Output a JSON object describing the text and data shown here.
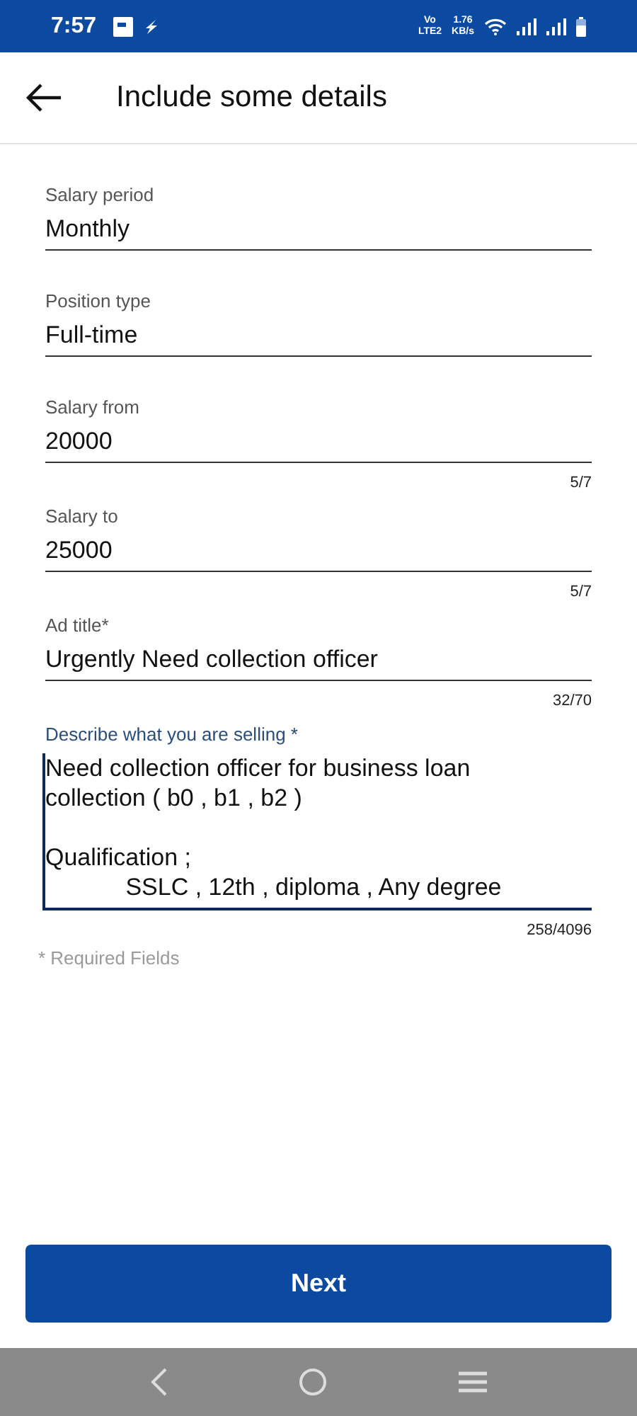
{
  "status_bar": {
    "time": "7:57",
    "network_top": "Vo",
    "network_bottom": "LTE2",
    "speed_value": "1.76",
    "speed_unit": "KB/s"
  },
  "header": {
    "title": "Include some details"
  },
  "fields": [
    {
      "label": "Salary period",
      "value": "Monthly",
      "focused": false
    },
    {
      "label": "Position type",
      "value": "Full-time",
      "focused": false
    },
    {
      "label": "Salary from",
      "value": "20000",
      "counter": "5/7",
      "focused": false
    },
    {
      "label": "Salary to",
      "value": "25000",
      "counter": "5/7",
      "focused": false
    },
    {
      "label": "Ad title*",
      "value": "Urgently Need collection officer",
      "counter": "32/70",
      "focused": false
    },
    {
      "label": "Describe what you are selling *",
      "value": "Need collection officer for business loan collection ( b0 , b1 , b2 )\n\nQualification ;\n            SSLC , 12th , diploma , Any degree",
      "counter": "258/4096",
      "focused": true
    }
  ],
  "required_note": "* Required Fields",
  "next_button": "Next"
}
